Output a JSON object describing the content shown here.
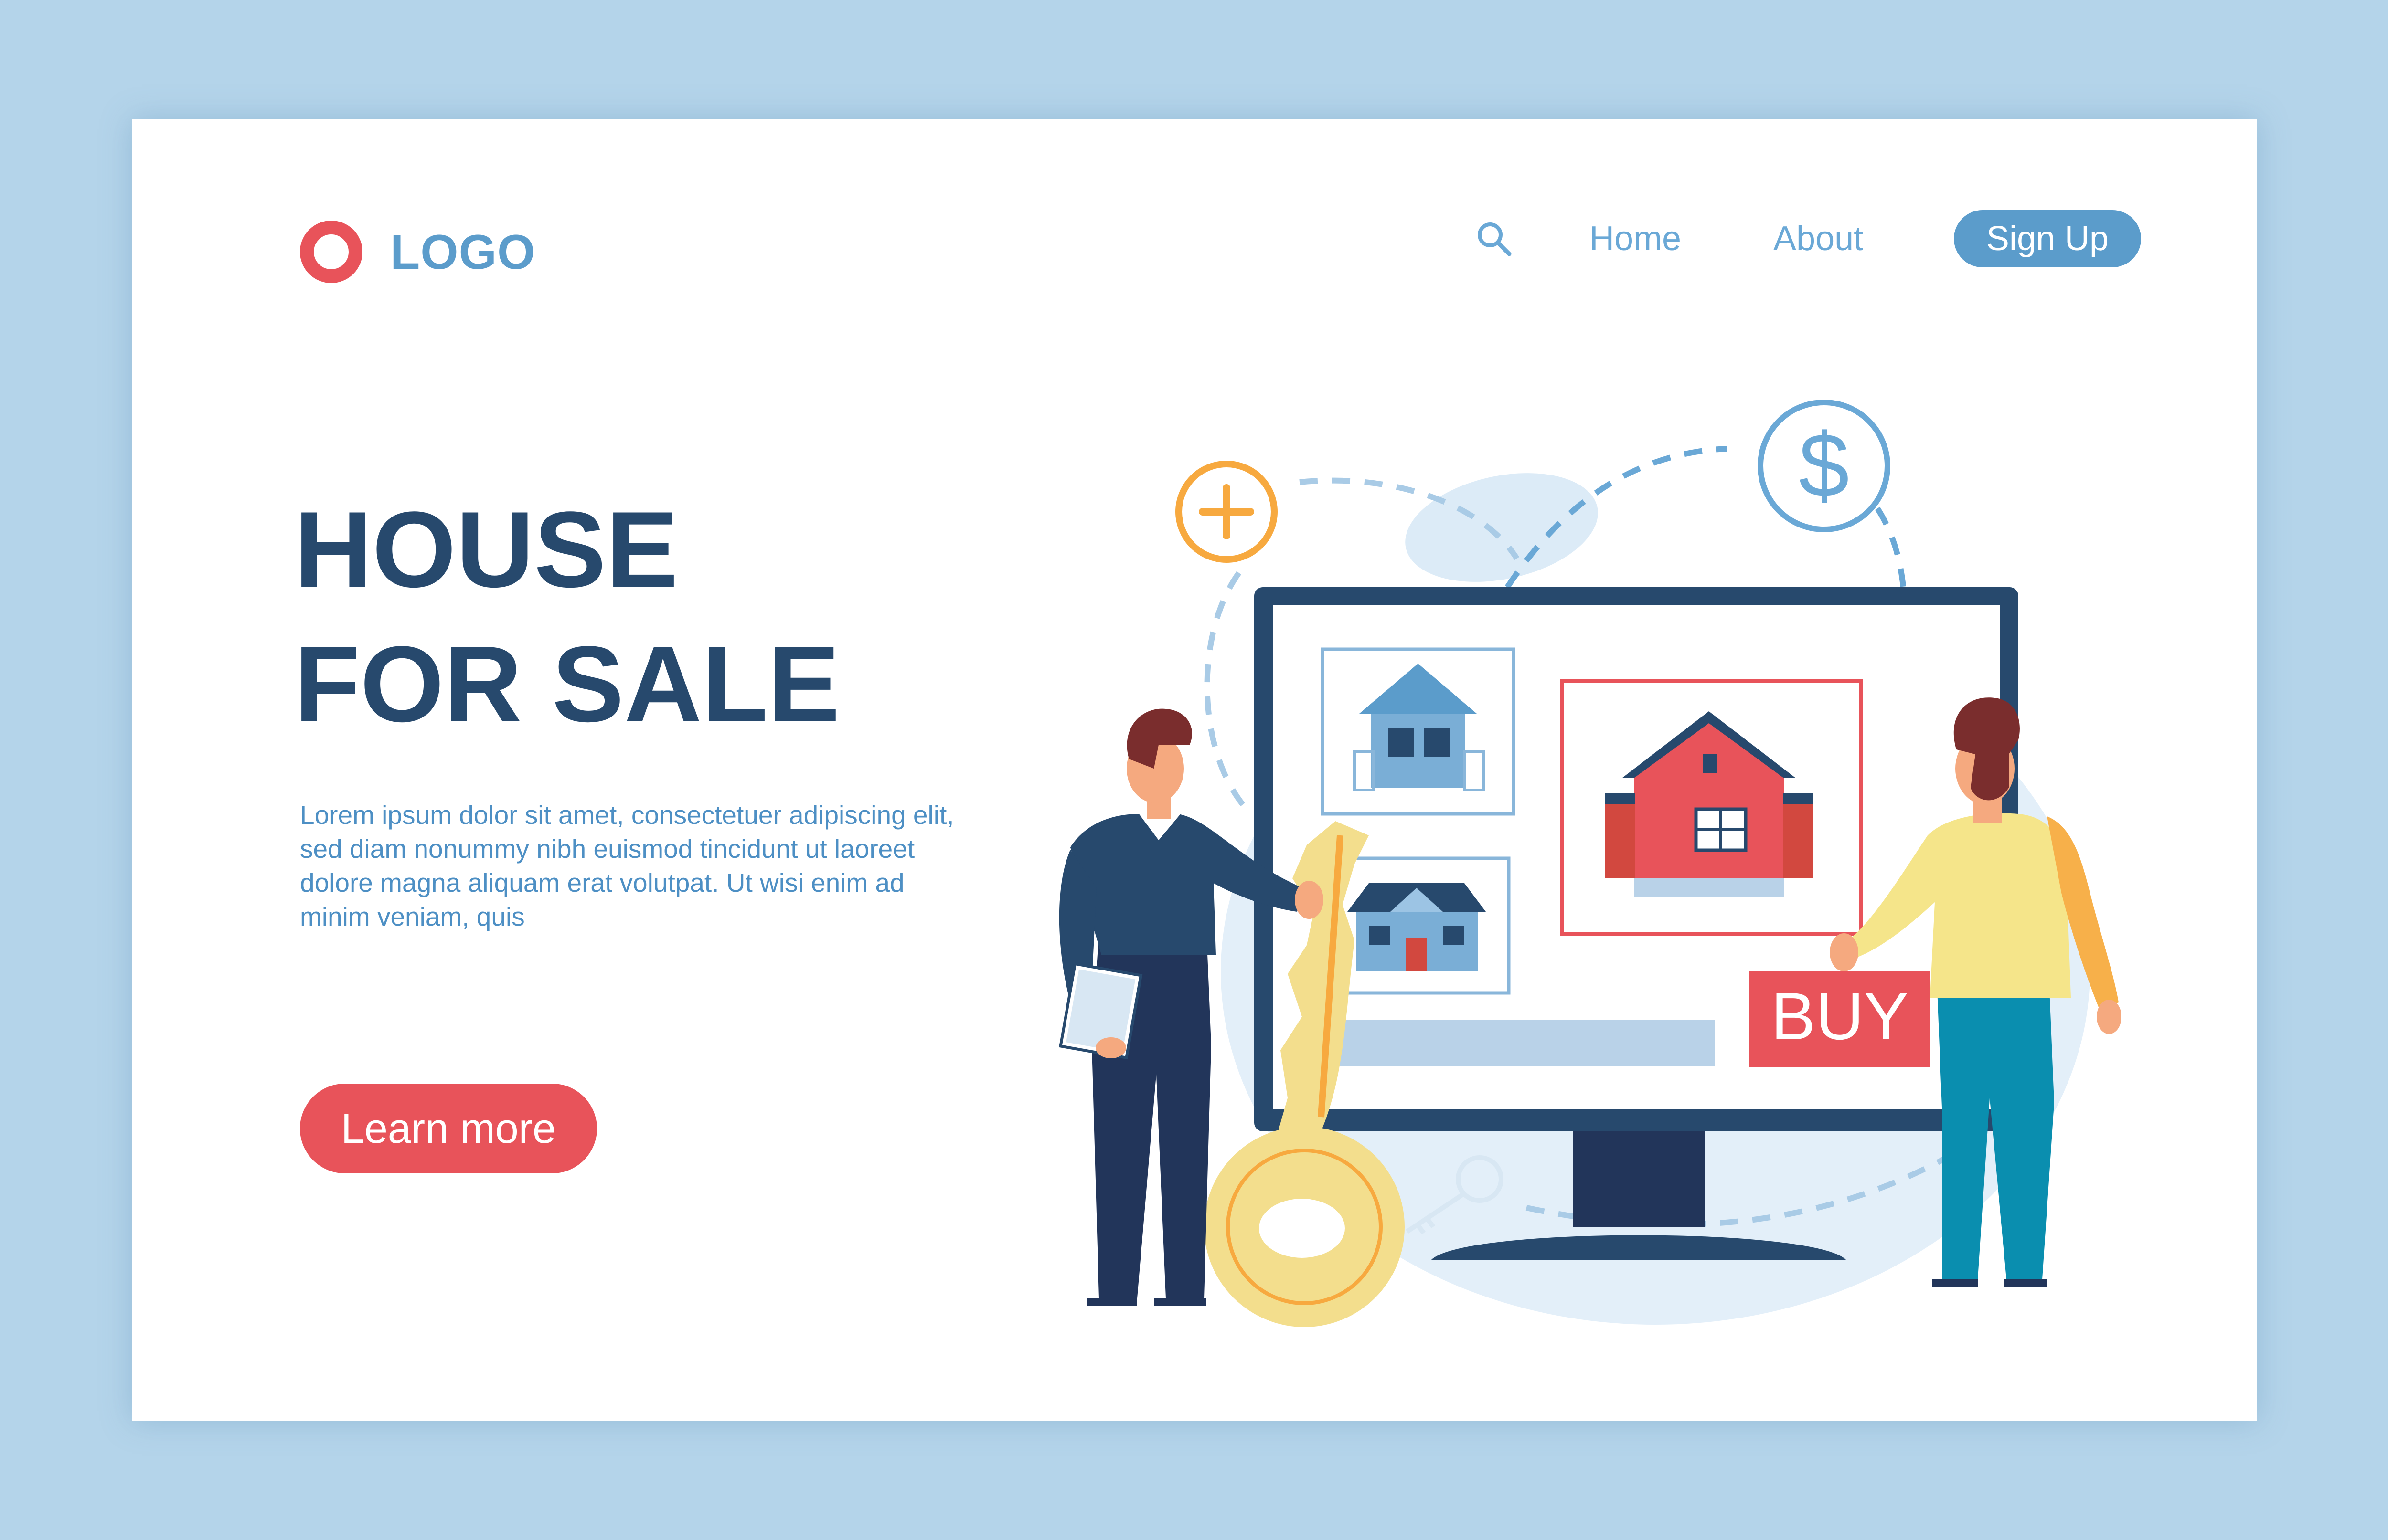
{
  "header": {
    "logo_text": "LOGO",
    "nav": {
      "home": "Home",
      "about": "About",
      "signup": "Sign Up"
    },
    "search_icon": "search-icon"
  },
  "hero": {
    "title_line1": "HOUSE",
    "title_line2": "FOR SALE",
    "description": "Lorem ipsum dolor sit amet, consectetuer adipiscing elit, sed diam nonummy nibh euismod tincidunt ut laoreet dolore magna aliquam erat volutpat. Ut wisi enim ad minim veniam, quis",
    "cta": "Learn more"
  },
  "illustration": {
    "buy_label": "BUY",
    "plus_symbol": "+",
    "dollar_symbol": "$"
  },
  "colors": {
    "background": "#b4d4ea",
    "accent_red": "#e8535a",
    "accent_blue": "#5b9ccb",
    "headline": "#27496d"
  }
}
